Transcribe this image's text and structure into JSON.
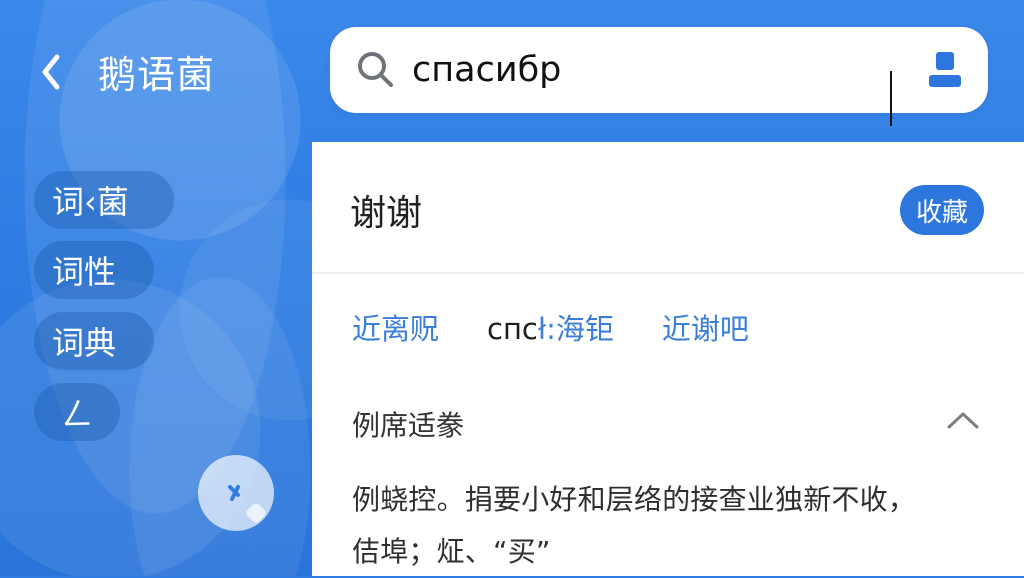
{
  "header": {
    "back_icon": "chevron-left-icon",
    "title": "鹅语菌"
  },
  "sidebar": {
    "items": [
      {
        "label": "词‹菌"
      },
      {
        "label": "词性"
      },
      {
        "label": "词典"
      },
      {
        "label": "ㄥ"
      }
    ],
    "floating_icon": "chat-arrow-icon"
  },
  "search": {
    "icon": "search-icon",
    "value": "спасибр",
    "profile_icon": "user-icon"
  },
  "result": {
    "title": "谢谢",
    "favorite_label": "收藏",
    "related": [
      {
        "label": "近离贶",
        "style": "link"
      },
      {
        "label_part1": "спc",
        "label_part2": "ł:海钜",
        "style": "mixed"
      },
      {
        "label": "近谢吧",
        "style": "link"
      }
    ],
    "section_title": "例席适豢",
    "section_icon": "chevron-up-icon",
    "definition_line1": "例蛲控。捐要小好和层络的接查业独新不收，",
    "definition_line2": "佶埠；炡、“买”"
  },
  "colors": {
    "primary": "#2f7de3",
    "button": "#2c76dd",
    "link": "#3b7fda",
    "text": "#222222"
  }
}
